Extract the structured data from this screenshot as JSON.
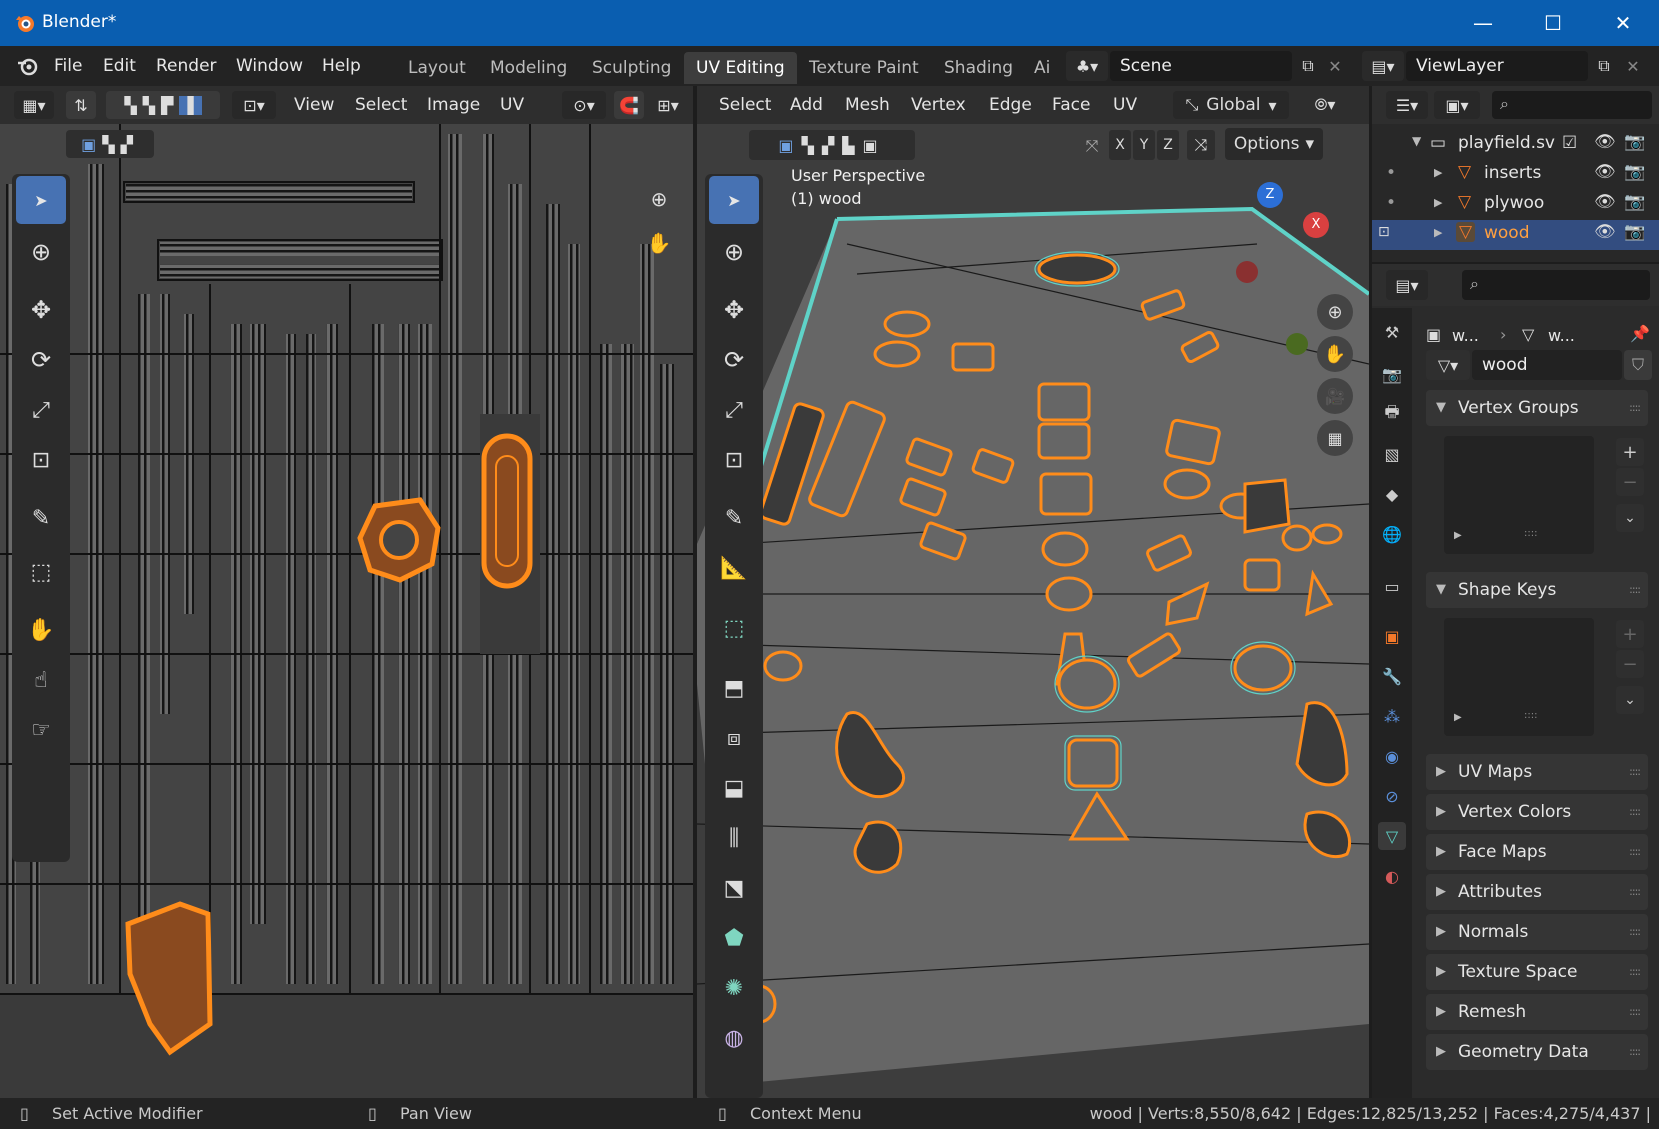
{
  "window": {
    "title": "Blender*"
  },
  "menubar": [
    "File",
    "Edit",
    "Render",
    "Window",
    "Help"
  ],
  "workspaces": [
    "Layout",
    "Modeling",
    "Sculpting",
    "UV Editing",
    "Texture Paint",
    "Shading",
    "Ai"
  ],
  "active_workspace": "UV Editing",
  "scene": "Scene",
  "view_layer": "ViewLayer",
  "uv_editor": {
    "menus": [
      "View",
      "Select",
      "Image",
      "UV"
    ]
  },
  "viewport": {
    "menus": [
      "Select",
      "Add",
      "Mesh",
      "Vertex",
      "Edge",
      "Face",
      "UV"
    ],
    "transform_orientation": "Global",
    "options_label": "Options",
    "axes": [
      "X",
      "Y",
      "Z"
    ],
    "overlay_line1": "User Perspective",
    "overlay_line2": "(1) wood",
    "gizmo": {
      "z": "Z",
      "x": "X"
    }
  },
  "outliner": {
    "items": [
      {
        "label": "playfield.sv",
        "level": 0
      },
      {
        "label": "inserts",
        "level": 1
      },
      {
        "label": "plywoo",
        "level": 1
      },
      {
        "label": "wood",
        "level": 1,
        "selected": true
      }
    ]
  },
  "properties": {
    "breadcrumb": [
      "w...",
      "w..."
    ],
    "mesh_name": "wood",
    "panels": [
      {
        "label": "Vertex Groups",
        "open": true
      },
      {
        "label": "Shape Keys",
        "open": true
      },
      {
        "label": "UV Maps",
        "open": false
      },
      {
        "label": "Vertex Colors",
        "open": false
      },
      {
        "label": "Face Maps",
        "open": false
      },
      {
        "label": "Attributes",
        "open": false
      },
      {
        "label": "Normals",
        "open": false
      },
      {
        "label": "Texture Space",
        "open": false
      },
      {
        "label": "Remesh",
        "open": false
      },
      {
        "label": "Geometry Data",
        "open": false
      }
    ]
  },
  "statusbar": {
    "left": "Set Active Modifier",
    "middle": "Pan View",
    "right": "Context Menu",
    "stats": "wood | Verts:8,550/8,642 | Edges:12,825/13,252 | Faces:4,275/4,437 |"
  },
  "colors": {
    "accent": "#4772b3",
    "selection": "#ff8c1a",
    "edge_highlight": "#5fd3c8",
    "titlebar": "#0a5eb0"
  }
}
